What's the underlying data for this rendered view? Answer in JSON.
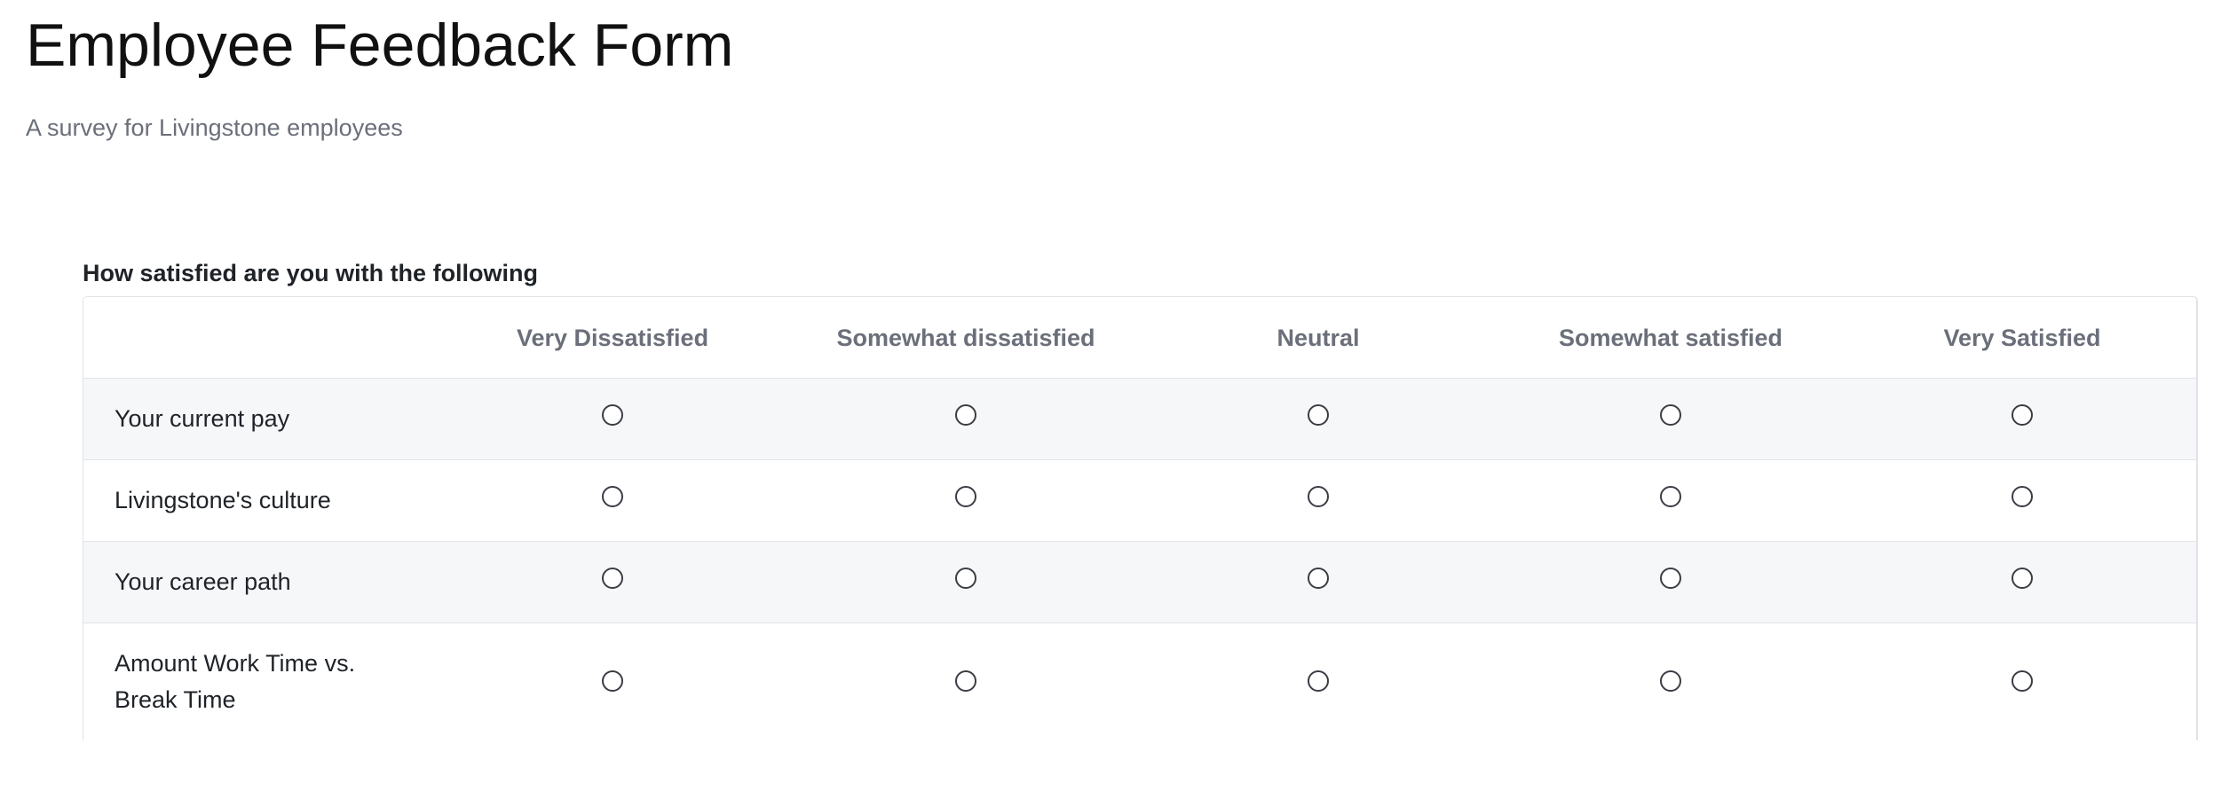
{
  "page": {
    "title": "Employee Feedback Form",
    "subtitle": "A survey for Livingstone employees"
  },
  "question": {
    "title": "How satisfied are you with the following",
    "columns": [
      "Very Dissatisfied",
      "Somewhat dissatisfied",
      "Neutral",
      "Somewhat satisfied",
      "Very Satisfied"
    ],
    "rows": [
      {
        "label": "Your current pay",
        "selected": null
      },
      {
        "label": "Livingstone's culture",
        "selected": null
      },
      {
        "label": "Your career path",
        "selected": null
      },
      {
        "label": "Amount Work Time vs. Break Time",
        "selected": null
      }
    ]
  },
  "colors": {
    "title": "#111111",
    "muted_text": "#6b6f7a",
    "body_text": "#1f2328",
    "border": "#e1e3e8",
    "shaded_row": "#f6f7f9",
    "radio_border": "#3a3d44"
  }
}
